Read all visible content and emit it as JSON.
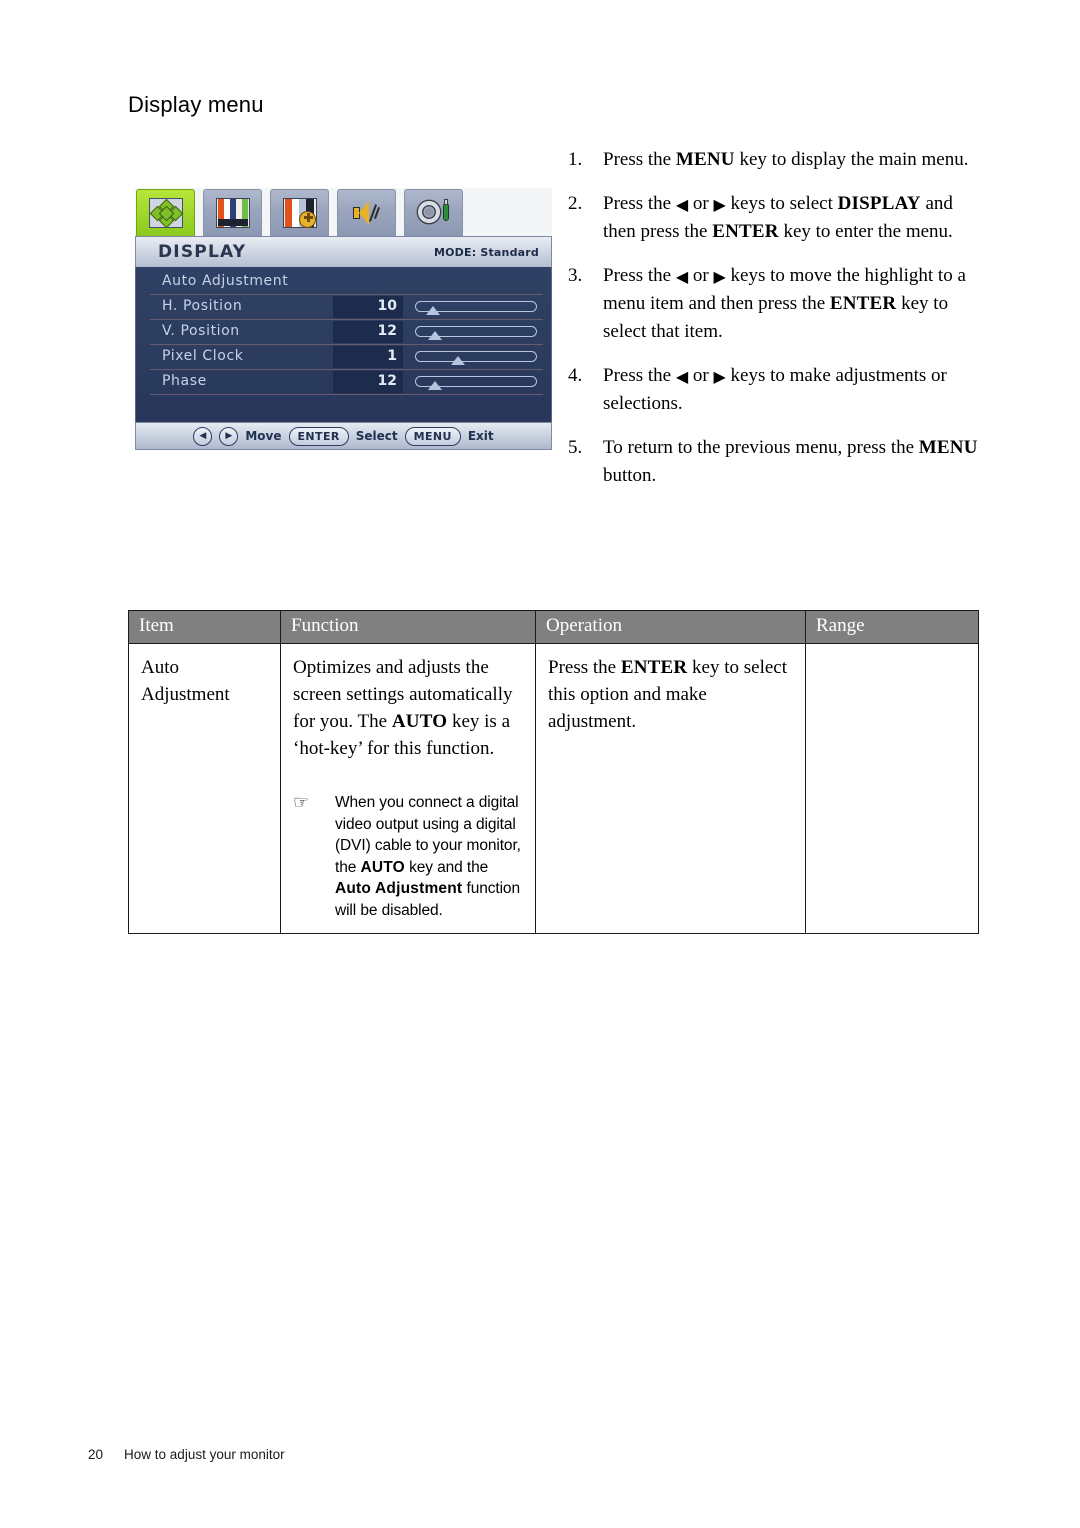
{
  "page": {
    "heading": "Display menu",
    "footer_page_number": "20",
    "footer_text": "How to adjust your monitor"
  },
  "osd": {
    "title": "DISPLAY",
    "mode_label": "MODE: Standard",
    "tabs": [
      {
        "name": "display-tab",
        "active": true
      },
      {
        "name": "picture-tab",
        "active": false
      },
      {
        "name": "picture-advanced-tab",
        "active": false
      },
      {
        "name": "audio-tab",
        "active": false
      },
      {
        "name": "system-tab",
        "active": false
      }
    ],
    "rows": [
      {
        "label": "Auto Adjustment",
        "value": "",
        "slider": false,
        "knob_pct": 0
      },
      {
        "label": "H. Position",
        "value": "10",
        "slider": true,
        "knob_pct": 14
      },
      {
        "label": "V. Position",
        "value": "12",
        "slider": true,
        "knob_pct": 16
      },
      {
        "label": "Pixel Clock",
        "value": "1",
        "slider": true,
        "knob_pct": 35
      },
      {
        "label": "Phase",
        "value": "12",
        "slider": true,
        "knob_pct": 16
      }
    ],
    "footer": {
      "left_arrow": "◀",
      "right_arrow": "▶",
      "move_label": "Move",
      "enter_label": "ENTER",
      "select_label": "Select",
      "menu_label": "MENU",
      "exit_label": "Exit"
    },
    "colors": {
      "active_tab": "#9ed629",
      "body_bg": "#2b3c5e",
      "value_bg": "#1d2c4c"
    }
  },
  "steps": [
    {
      "num": "1.",
      "parts": [
        {
          "t": "Press the ",
          "s": "n"
        },
        {
          "t": "MENU",
          "s": "b"
        },
        {
          "t": " key to display the main menu.",
          "s": "n"
        }
      ]
    },
    {
      "num": "2.",
      "parts": [
        {
          "t": "Press the ",
          "s": "n"
        },
        {
          "t": "◀",
          "s": "a"
        },
        {
          "t": " or ",
          "s": "n"
        },
        {
          "t": "▶",
          "s": "a"
        },
        {
          "t": " keys to select ",
          "s": "n"
        },
        {
          "t": "DISPLAY",
          "s": "b"
        },
        {
          "t": " and then press the ",
          "s": "n"
        },
        {
          "t": "ENTER",
          "s": "b"
        },
        {
          "t": " key to enter the menu.",
          "s": "n"
        }
      ]
    },
    {
      "num": "3.",
      "parts": [
        {
          "t": "Press the ",
          "s": "n"
        },
        {
          "t": "◀",
          "s": "a"
        },
        {
          "t": " or ",
          "s": "n"
        },
        {
          "t": "▶",
          "s": "a"
        },
        {
          "t": " keys to move the highlight to a menu item and then press the ",
          "s": "n"
        },
        {
          "t": "ENTER",
          "s": "b"
        },
        {
          "t": " key to select that item.",
          "s": "n"
        }
      ]
    },
    {
      "num": "4.",
      "parts": [
        {
          "t": "Press the ",
          "s": "n"
        },
        {
          "t": "◀",
          "s": "a"
        },
        {
          "t": " or ",
          "s": "n"
        },
        {
          "t": "▶",
          "s": "a"
        },
        {
          "t": " keys to make adjustments or selections.",
          "s": "n"
        }
      ]
    },
    {
      "num": "5.",
      "parts": [
        {
          "t": "To return to the previous menu, press the ",
          "s": "n"
        },
        {
          "t": "MENU",
          "s": "b"
        },
        {
          "t": " button.",
          "s": "n"
        }
      ]
    }
  ],
  "table": {
    "headers": [
      "Item",
      "Function",
      "Operation",
      "Range"
    ],
    "rows": [
      {
        "item": "Auto Adjustment",
        "function_parts": [
          {
            "t": "Optimizes and adjusts the screen settings automatically for you. The ",
            "s": "n"
          },
          {
            "t": "AUTO",
            "s": "b"
          },
          {
            "t": " key is a ‘hot-key’ for this function.",
            "s": "n"
          }
        ],
        "note_icon": "☞",
        "note_parts": [
          {
            "t": "When you connect a digital video output using a digital (DVI) cable to your monitor, the ",
            "s": "n"
          },
          {
            "t": "AUTO",
            "s": "b"
          },
          {
            "t": " key and the ",
            "s": "n"
          },
          {
            "t": "Auto Adjustment",
            "s": "b"
          },
          {
            "t": " function will be disabled.",
            "s": "n"
          }
        ],
        "operation_parts": [
          {
            "t": "Press the ",
            "s": "n"
          },
          {
            "t": "ENTER",
            "s": "b"
          },
          {
            "t": " key to select this option and make adjustment.",
            "s": "n"
          }
        ],
        "range": ""
      }
    ]
  }
}
